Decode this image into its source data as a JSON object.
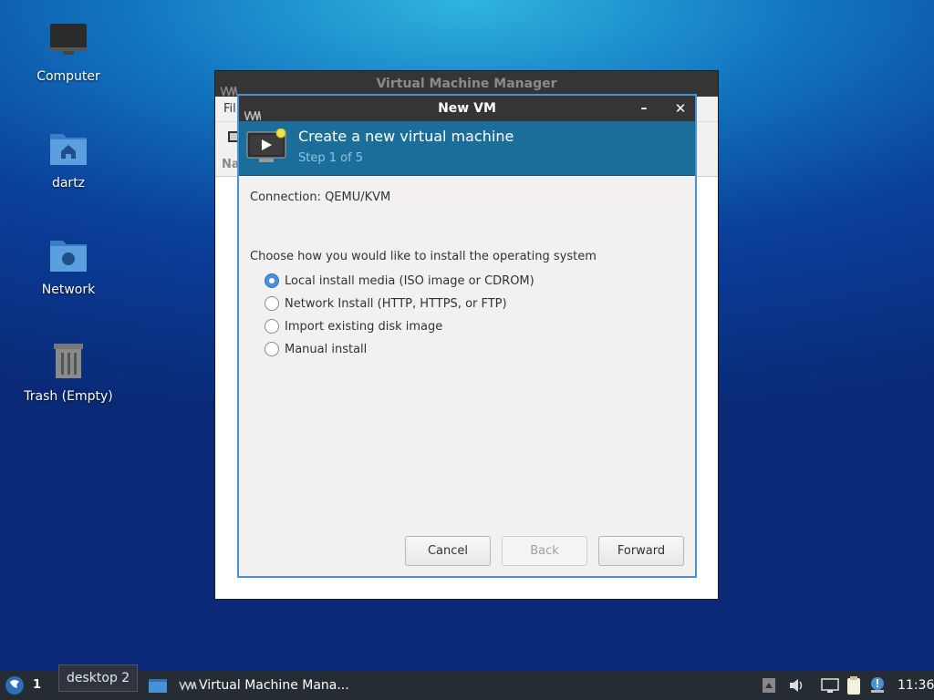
{
  "desktop": {
    "icons": [
      {
        "label": "Computer"
      },
      {
        "label": "dartz"
      },
      {
        "label": "Network"
      },
      {
        "label": "Trash (Empty)"
      }
    ]
  },
  "vmm_window": {
    "title": "Virtual Machine Manager",
    "menu_partial": "Fil",
    "column_partial": "Na"
  },
  "dialog": {
    "title": "New VM",
    "minimize_glyph": "–",
    "close_glyph": "✕",
    "header_title": "Create a new virtual machine",
    "header_step": "Step 1 of 5",
    "connection": "Connection:  QEMU/KVM",
    "prompt": "Choose how you would like to install the operating system",
    "options": [
      {
        "label": "Local install media (ISO image or CDROM)",
        "selected": true
      },
      {
        "label": "Network Install (HTTP, HTTPS, or FTP)",
        "selected": false
      },
      {
        "label": "Import existing disk image",
        "selected": false
      },
      {
        "label": "Manual install",
        "selected": false
      }
    ],
    "buttons": {
      "cancel": "Cancel",
      "back": "Back",
      "forward": "Forward"
    }
  },
  "taskbar": {
    "workspace": "1",
    "tooltip": "desktop 2",
    "window_label": "Virtual Machine Mana...",
    "clock": "11:36"
  },
  "colors": {
    "accent": "#4a90d9",
    "header": "#1c6e9a",
    "taskbar": "#262c33"
  }
}
